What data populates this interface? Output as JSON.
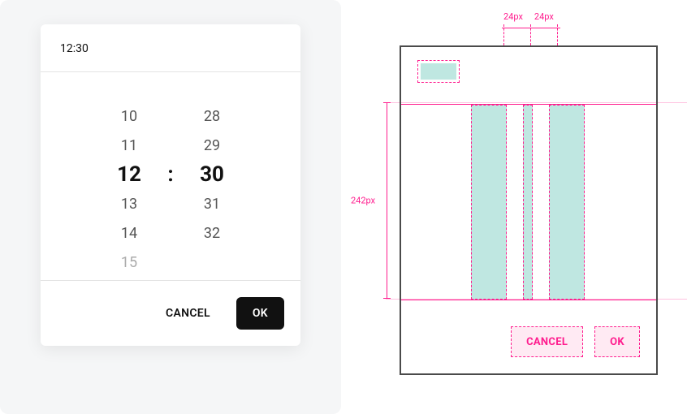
{
  "dialog": {
    "title": "12:30",
    "hour_cells": [
      "",
      "10",
      "11",
      "12",
      "13",
      "14",
      "15"
    ],
    "minute_cells": [
      "",
      "28",
      "29",
      "30",
      "31",
      "32",
      ""
    ],
    "colon": ":",
    "cancel_label": "CANCEL",
    "ok_label": "OK"
  },
  "spec": {
    "gap_label_left": "24px",
    "gap_label_right": "24px",
    "picker_height_label": "242px",
    "cancel_label": "CANCEL",
    "ok_label": "OK"
  }
}
